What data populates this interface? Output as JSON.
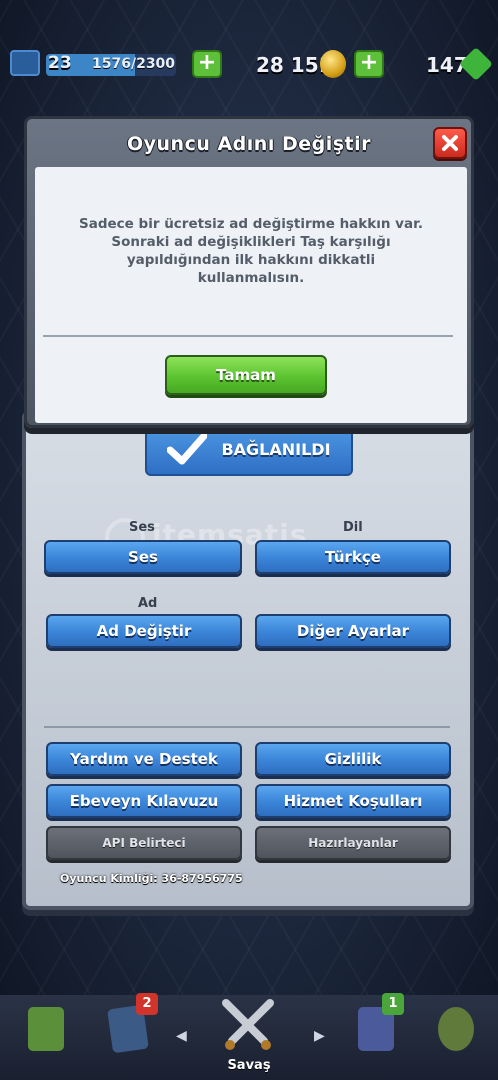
{
  "topbar": {
    "level": "23",
    "xp": "1576/2300",
    "xp_fraction": 0.685,
    "gold": "28 151",
    "gems": "147"
  },
  "dialog": {
    "title": "Oyuncu Adını Değiştir",
    "message": "Sadece bir ücretsiz ad değiştirme hakkın var. Sonraki ad değişiklikleri Taş karşılığı yapıldığından ilk hakkını dikkatli kullanmalısın.",
    "ok_label": "Tamam"
  },
  "settings": {
    "connected_label": "BAĞLANILDI",
    "sound_section": "Ses",
    "language_section": "Dil",
    "name_section": "Ad",
    "sound_button": "Ses",
    "language_button": "Türkçe",
    "change_name_button": "Ad Değiştir",
    "other_settings_button": "Diğer Ayarlar",
    "help_button": "Yardım ve Destek",
    "privacy_button": "Gizlilik",
    "parent_guide_button": "Ebeveyn Kılavuzu",
    "terms_button": "Hizmet Koşulları",
    "api_button": "API Belirteci",
    "credits_button": "Hazırlayanlar",
    "player_id": "Oyuncu Kimliği: 36-87956775"
  },
  "watermark": "itemsatis",
  "nav": {
    "cards_badge": "2",
    "clan_badge": "1",
    "battle_label": "Savaş"
  },
  "colors": {
    "blue_button": "#3a84d8",
    "green_button": "#5cc430",
    "close_red": "#cc2a1f",
    "gray_button": "#50555d"
  }
}
